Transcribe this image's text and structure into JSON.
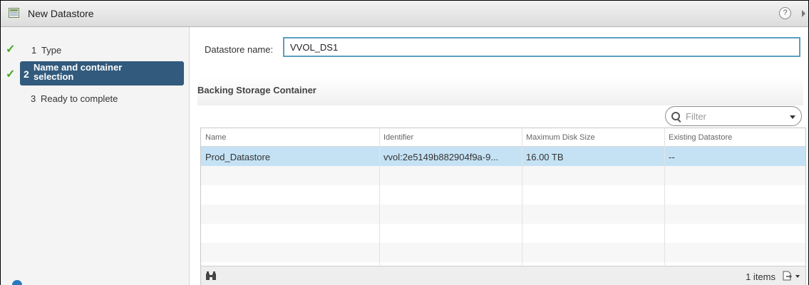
{
  "window": {
    "title": "New Datastore",
    "help_glyph": "?"
  },
  "steps": [
    {
      "number": "1",
      "label": "Type",
      "completed": true
    },
    {
      "number": "2",
      "label": "Name and container selection",
      "completed": true,
      "active": true
    },
    {
      "number": "3",
      "label": "Ready to complete",
      "completed": false
    }
  ],
  "form": {
    "name_label": "Datastore name:",
    "name_value": "VVOL_DS1"
  },
  "backing": {
    "title": "Backing Storage Container",
    "filter_placeholder": "Filter",
    "columns": [
      "Name",
      "Identifier",
      "Maximum Disk Size",
      "Existing Datastore"
    ],
    "rows": [
      {
        "name": "Prod_Datastore",
        "identifier": "vvol:2e5149b882904f9a-9...",
        "max_disk_size": "16.00 TB",
        "existing_datastore": "--"
      }
    ],
    "item_count": "1 items"
  },
  "colors": {
    "active_step": "#315a7c",
    "selected_row": "#c5e2f5",
    "check": "#43a820",
    "input_border": "#5a9fc2"
  },
  "icons": {
    "title": "new-datastore-icon",
    "help": "help-icon",
    "check": "checkmark-icon",
    "find": "binoculars-icon",
    "export": "export-icon"
  }
}
